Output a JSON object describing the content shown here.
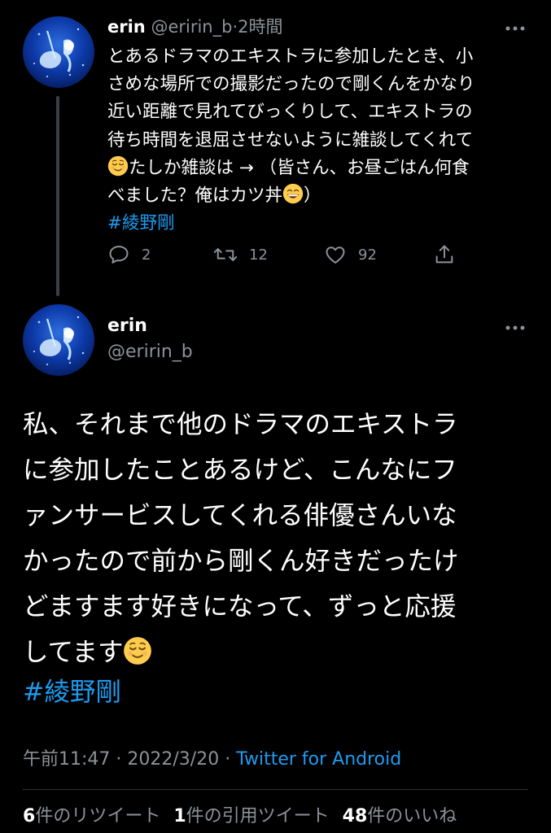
{
  "tweet1": {
    "name": "erin",
    "handle": "@eririn_b",
    "separator": "·",
    "time": "2時間",
    "lines": [
      "とあるドラマのエキストラに参加したとき、小",
      "さめな場所での撮影だったので剛くんをかなり",
      "近い距離で見れてびっくりして、エキストラの",
      "待ち時間を退屈させないように雑談してくれて",
      "たしか雑談は → （皆さん、お昼ごはん何食",
      "べました？俺はカツ丼",
      "）"
    ],
    "hashtag": "#綾野剛",
    "reply_count": "2",
    "retweet_count": "12",
    "like_count": "92"
  },
  "tweet2": {
    "name": "erin",
    "handle": "@eririn_b",
    "lines": [
      "私、それまで他のドラマのエキストラ",
      "に参加したことあるけど、こんなにフ",
      "ァンサービスしてくれる俳優さんいな",
      "かったので前から剛くん好きだったけ",
      "どますます好きになって、ずっと応援",
      "してます"
    ],
    "hashtag": "#綾野剛",
    "time": "午前11:47",
    "separator1": " · ",
    "date": "2022/3/20",
    "separator2": " · ",
    "source": "Twitter for Android",
    "retweets_num": "6",
    "retweets_label": "件のリツイート",
    "quotes_num": "1",
    "quotes_label": "件の引用ツイート",
    "likes_num": "48",
    "likes_label": "件のいいね"
  },
  "colors": {
    "background": "#000000",
    "text": "#ffffff",
    "secondary": "#8b9298",
    "link": "#1d9bf0",
    "divider": "#2f3336"
  },
  "icons": [
    "avatar",
    "more-icon",
    "reply-icon",
    "retweet-icon",
    "like-icon",
    "share-icon",
    "relieved-face-emoji",
    "grinning-face-emoji"
  ]
}
